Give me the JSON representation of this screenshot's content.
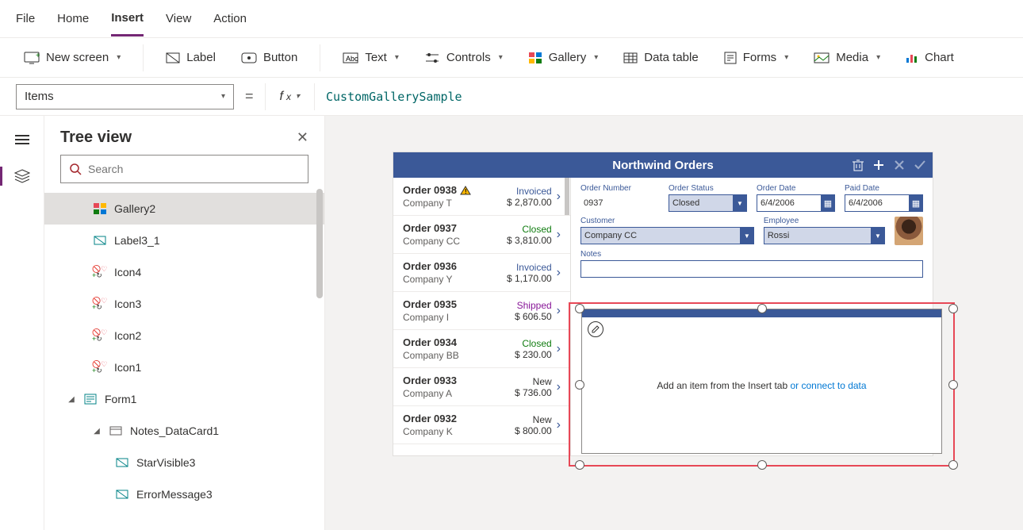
{
  "tabs": {
    "file": "File",
    "home": "Home",
    "insert": "Insert",
    "view": "View",
    "action": "Action"
  },
  "ribbon": {
    "newscreen": "New screen",
    "label": "Label",
    "button": "Button",
    "text": "Text",
    "controls": "Controls",
    "gallery": "Gallery",
    "datatable": "Data table",
    "forms": "Forms",
    "media": "Media",
    "chart": "Chart"
  },
  "property": "Items",
  "formula": "CustomGallerySample",
  "tree": {
    "title": "Tree view",
    "search_ph": "Search",
    "nodes": {
      "gallery2": "Gallery2",
      "label31": "Label3_1",
      "icon4": "Icon4",
      "icon3": "Icon3",
      "icon2": "Icon2",
      "icon1": "Icon1",
      "form1": "Form1",
      "notesdc": "Notes_DataCard1",
      "starvis": "StarVisible3",
      "errmsg": "ErrorMessage3"
    }
  },
  "app": {
    "title": "Northwind Orders",
    "form": {
      "ordernum_lbl": "Order Number",
      "ordernum": "0937",
      "status_lbl": "Order Status",
      "status": "Closed",
      "orderdate_lbl": "Order Date",
      "orderdate": "6/4/2006",
      "paiddate_lbl": "Paid Date",
      "paiddate": "6/4/2006",
      "customer_lbl": "Customer",
      "customer": "Company CC",
      "employee_lbl": "Employee",
      "employee": "Rossi",
      "notes_lbl": "Notes"
    },
    "orders": [
      {
        "id": "Order 0938",
        "company": "Company T",
        "price": "$ 2,870.00",
        "status": "Invoiced",
        "cls": "st-invoiced",
        "warn": true
      },
      {
        "id": "Order 0937",
        "company": "Company CC",
        "price": "$ 3,810.00",
        "status": "Closed",
        "cls": "st-closed"
      },
      {
        "id": "Order 0936",
        "company": "Company Y",
        "price": "$ 1,170.00",
        "status": "Invoiced",
        "cls": "st-invoiced"
      },
      {
        "id": "Order 0935",
        "company": "Company I",
        "price": "$ 606.50",
        "status": "Shipped",
        "cls": "st-shipped"
      },
      {
        "id": "Order 0934",
        "company": "Company BB",
        "price": "$ 230.00",
        "status": "Closed",
        "cls": "st-closed"
      },
      {
        "id": "Order 0933",
        "company": "Company A",
        "price": "$ 736.00",
        "status": "New",
        "cls": "st-new"
      },
      {
        "id": "Order 0932",
        "company": "Company K",
        "price": "$ 800.00",
        "status": "New",
        "cls": "st-new"
      }
    ],
    "hint_pre": "Add an item from the Insert tab ",
    "hint_link": "or connect to data"
  }
}
